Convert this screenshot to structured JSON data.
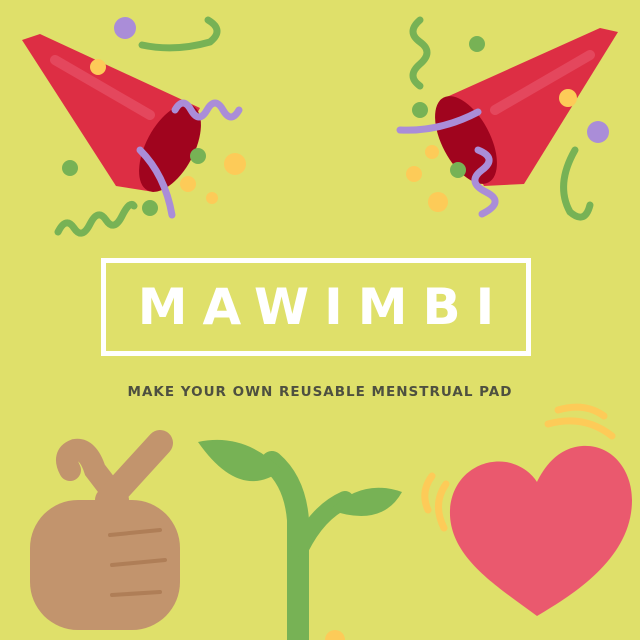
{
  "brand": {
    "name": "MAWIMBI"
  },
  "tagline": "MAKE YOUR OWN REUSABLE MENSTRUAL PAD",
  "colors": {
    "background": "#DFE06A",
    "text_white": "#FFFFFF",
    "tagline": "#4E5040",
    "cone_red": "#DD2E44",
    "cone_dark": "#A0041E",
    "confetti_purple": "#AA8DD8",
    "confetti_green": "#77B255",
    "confetti_yellow": "#FDCB58",
    "hand_skin": "#C2946D",
    "sprout_green": "#77B255",
    "heart_pink": "#EA596E"
  },
  "icons": [
    "party-popper-icon",
    "party-popper-icon",
    "pointing-hand-icon",
    "seedling-icon",
    "beating-heart-icon"
  ]
}
